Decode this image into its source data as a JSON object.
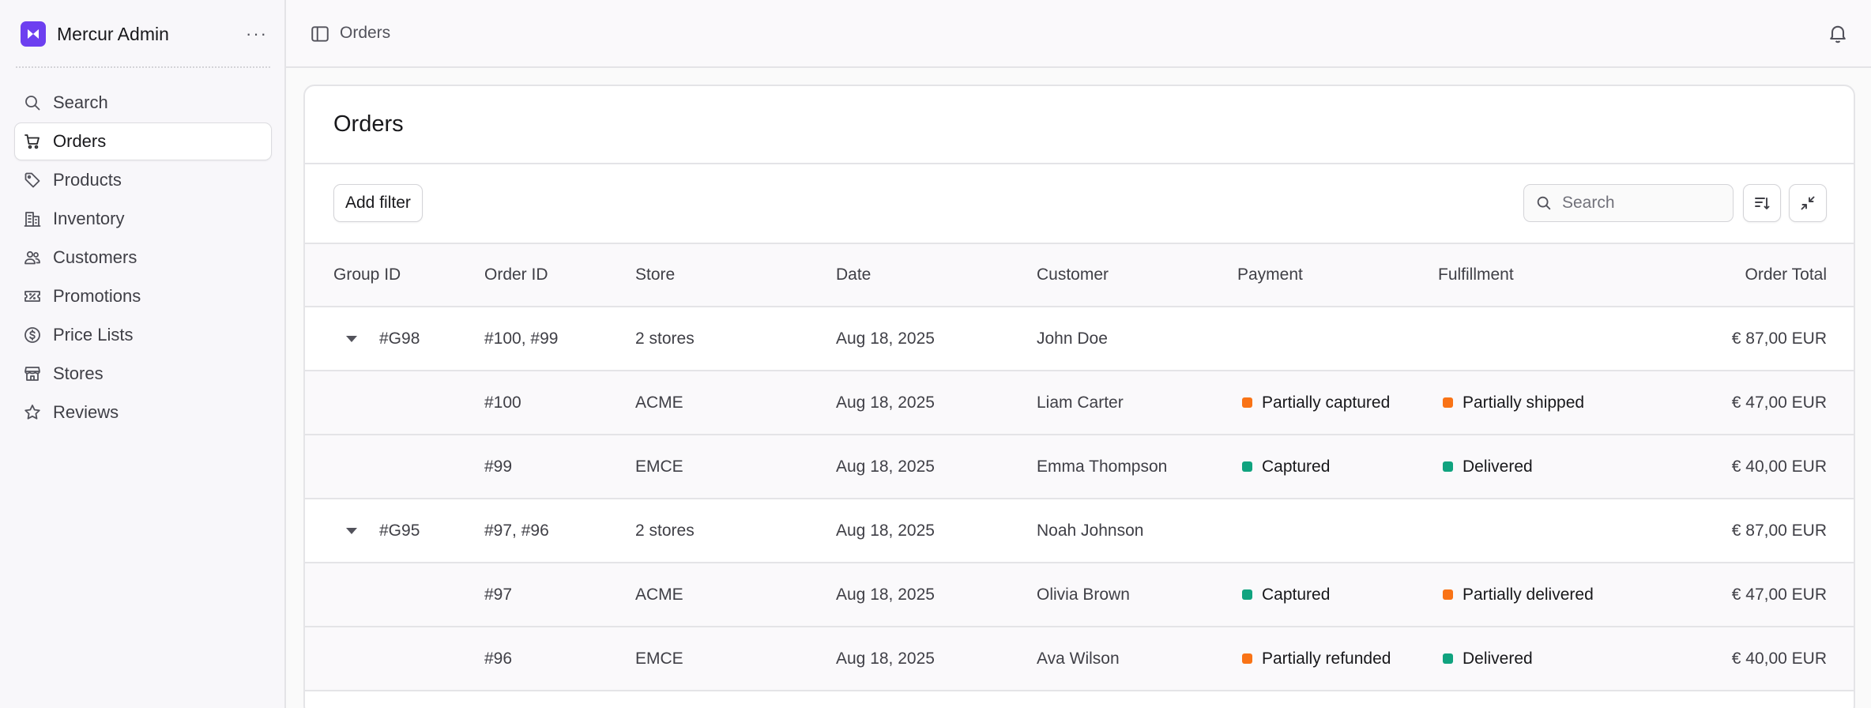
{
  "app": {
    "name": "Mercur Admin",
    "more": "···"
  },
  "sidebar": {
    "items": [
      {
        "label": "Search",
        "icon": "search-icon"
      },
      {
        "label": "Orders",
        "icon": "cart-icon",
        "active": true
      },
      {
        "label": "Products",
        "icon": "tag-icon"
      },
      {
        "label": "Inventory",
        "icon": "building-icon"
      },
      {
        "label": "Customers",
        "icon": "users-icon"
      },
      {
        "label": "Promotions",
        "icon": "ticket-icon"
      },
      {
        "label": "Price Lists",
        "icon": "dollar-circle-icon"
      },
      {
        "label": "Stores",
        "icon": "store-icon"
      },
      {
        "label": "Reviews",
        "icon": "star-icon"
      }
    ]
  },
  "topbar": {
    "breadcrumb": "Orders"
  },
  "main": {
    "title": "Orders",
    "add_filter_label": "Add filter",
    "search_placeholder": "Search",
    "columns": [
      "Group ID",
      "Order ID",
      "Store",
      "Date",
      "Customer",
      "Payment",
      "Fulfillment",
      "Order Total"
    ],
    "rows": [
      {
        "group": "#G98",
        "order": "#100, #99",
        "store": "2 stores",
        "date": "Aug 18, 2025",
        "customer": "John Doe",
        "payment": "",
        "fulfillment": "",
        "total": "€ 87,00 EUR"
      },
      {
        "group": "",
        "order": "#100",
        "store": "ACME",
        "date": "Aug 18, 2025",
        "customer": "Liam Carter",
        "payment": "Partially captured",
        "payment_color": "#f97316",
        "fulfillment": "Partially shipped",
        "fulfillment_color": "#f97316",
        "total": "€ 47,00 EUR"
      },
      {
        "group": "",
        "order": "#99",
        "store": "EMCE",
        "date": "Aug 18, 2025",
        "customer": "Emma Thompson",
        "payment": "Captured",
        "payment_color": "#10a37f",
        "fulfillment": "Delivered",
        "fulfillment_color": "#10a37f",
        "total": "€ 40,00 EUR"
      },
      {
        "group": "#G95",
        "order": "#97, #96",
        "store": "2 stores",
        "date": "Aug 18, 2025",
        "customer": "Noah Johnson",
        "payment": "",
        "fulfillment": "",
        "total": "€ 87,00 EUR"
      },
      {
        "group": "",
        "order": "#97",
        "store": "ACME",
        "date": "Aug 18, 2025",
        "customer": "Olivia Brown",
        "payment": "Captured",
        "payment_color": "#10a37f",
        "fulfillment": "Partially delivered",
        "fulfillment_color": "#f97316",
        "total": "€ 47,00 EUR"
      },
      {
        "group": "",
        "order": "#96",
        "store": "EMCE",
        "date": "Aug 18, 2025",
        "customer": "Ava Wilson",
        "payment": "Partially refunded",
        "payment_color": "#f97316",
        "fulfillment": "Delivered",
        "fulfillment_color": "#10a37f",
        "total": "€ 40,00 EUR"
      }
    ]
  },
  "colors": {
    "brand": "#6d3ff0",
    "warning": "#f97316",
    "success": "#10a37f"
  }
}
